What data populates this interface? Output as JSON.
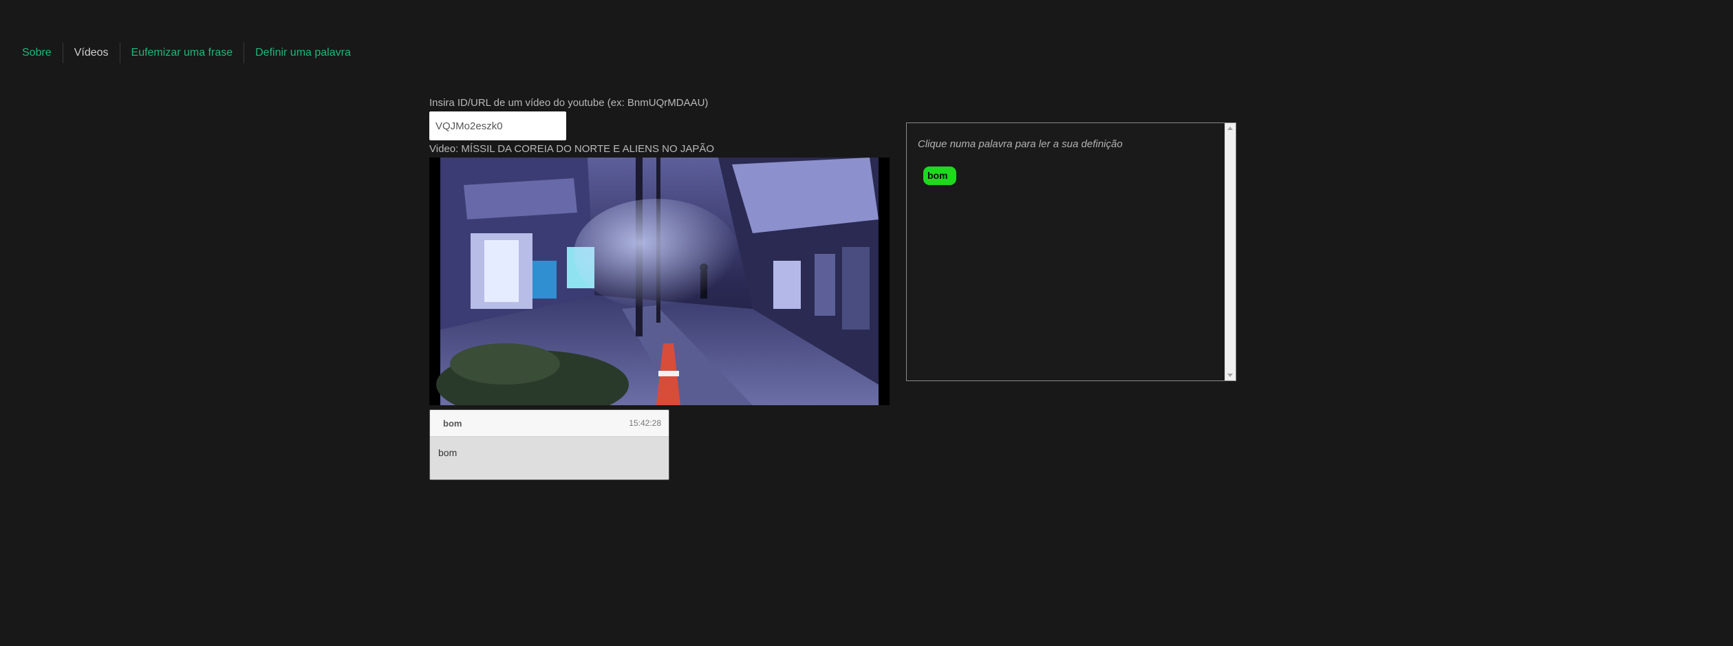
{
  "nav": {
    "items": [
      {
        "label": "Sobre",
        "active": false
      },
      {
        "label": "Vídeos",
        "active": true
      },
      {
        "label": "Eufemizar uma frase",
        "active": false
      },
      {
        "label": "Definir uma palavra",
        "active": false
      }
    ]
  },
  "form": {
    "label": "Insira ID/URL de um vídeo do youtube (ex: BnmUQrMDAAU)",
    "value": "VQJMo2eszk0"
  },
  "video": {
    "title": "Video: MÍSSIL DA COREIA DO NORTE E ALIENS NO JAPÃO"
  },
  "subtitle_card": {
    "speaker": "bom",
    "time": "15:42:28",
    "text": "bom"
  },
  "definition_panel": {
    "hint": "Clique numa palavra para ler a sua definição",
    "words": [
      "bom"
    ]
  },
  "colors": {
    "background": "#181818",
    "link": "#1db87a",
    "chip": "#1fd81f"
  }
}
